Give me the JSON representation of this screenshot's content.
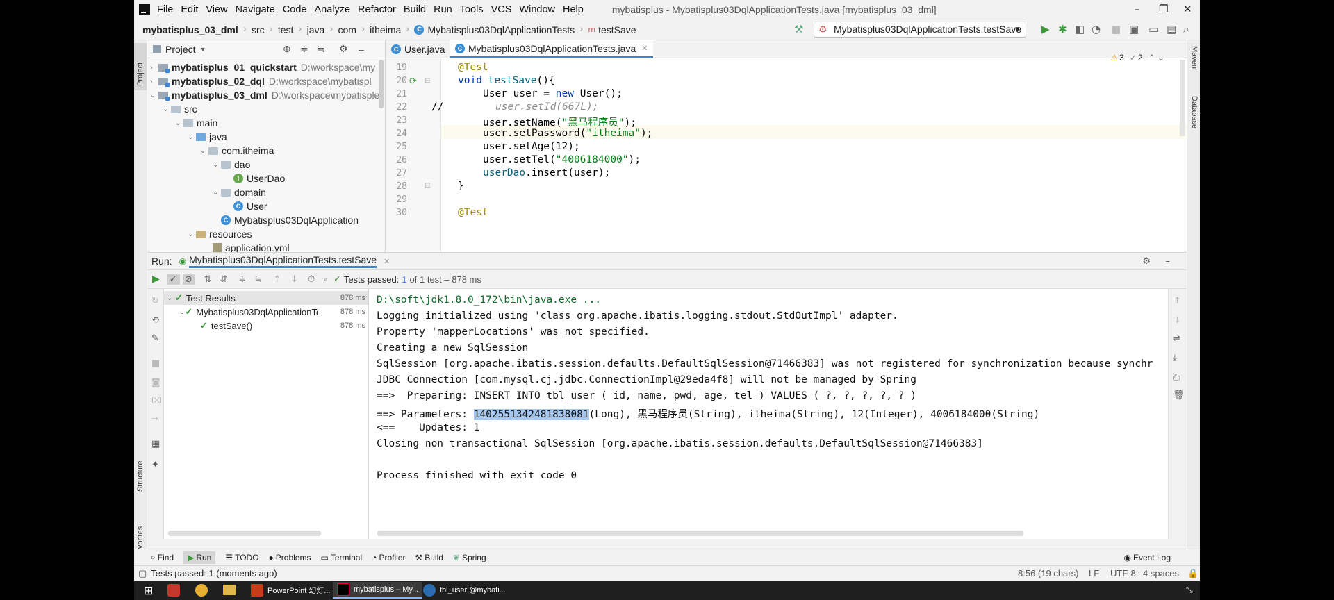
{
  "menubar": {
    "items": [
      "File",
      "Edit",
      "View",
      "Navigate",
      "Code",
      "Analyze",
      "Refactor",
      "Build",
      "Run",
      "Tools",
      "VCS",
      "Window",
      "Help"
    ],
    "window_title": "mybatisplus - Mybatisplus03DqlApplicationTests.java [mybatisplus_03_dml]"
  },
  "breadcrumb": [
    "mybatisplus_03_dml",
    "src",
    "test",
    "java",
    "com",
    "itheima",
    "Mybatisplus03DqlApplicationTests",
    "testSave"
  ],
  "toolbar": {
    "run_config": "Mybatisplus03DqlApplicationTests.testSave"
  },
  "side_strips": {
    "left": [
      "Project",
      "Structure",
      "Favorites"
    ],
    "right": [
      "Maven",
      "Database"
    ]
  },
  "project": {
    "title": "Project",
    "tree": [
      {
        "label": "mybatisplus_01_quickstart",
        "path": "D:\\workspace\\my",
        "type": "module"
      },
      {
        "label": "mybatisplus_02_dql",
        "path": "D:\\workspace\\mybatispl",
        "type": "module"
      },
      {
        "label": "mybatisplus_03_dml",
        "path": "D:\\workspace\\mybatisple",
        "type": "module"
      },
      {
        "label": "src",
        "type": "folder"
      },
      {
        "label": "main",
        "type": "folder"
      },
      {
        "label": "java",
        "type": "src"
      },
      {
        "label": "com.itheima",
        "type": "folder"
      },
      {
        "label": "dao",
        "type": "folder"
      },
      {
        "label": "UserDao",
        "type": "interface"
      },
      {
        "label": "domain",
        "type": "folder"
      },
      {
        "label": "User",
        "type": "class"
      },
      {
        "label": "Mybatisplus03DqlApplication",
        "type": "class"
      },
      {
        "label": "resources",
        "type": "res"
      },
      {
        "label": "application.yml",
        "type": "yml"
      }
    ]
  },
  "editor": {
    "tabs": [
      {
        "label": "User.java"
      },
      {
        "label": "Mybatisplus03DqlApplicationTests.java"
      }
    ],
    "inspections": {
      "warnings": "3",
      "weak": "2"
    },
    "lines": [
      {
        "n": "19",
        "text": "@Test"
      },
      {
        "n": "20",
        "text": "void testSave(){"
      },
      {
        "n": "21",
        "text": "User user = new User();"
      },
      {
        "n": "22",
        "text": "user.setId(667L);"
      },
      {
        "n": "23",
        "text": "user.setName(\"黑马程序员\");"
      },
      {
        "n": "24",
        "text": "user.setPassword(\"itheima\");"
      },
      {
        "n": "25",
        "text": "user.setAge(12);"
      },
      {
        "n": "26",
        "text": "user.setTel(\"4006184000\");"
      },
      {
        "n": "27",
        "text": "userDao.insert(user);"
      },
      {
        "n": "28",
        "text": "}"
      },
      {
        "n": "29",
        "text": ""
      },
      {
        "n": "30",
        "text": "@Test"
      }
    ],
    "comment_marker": "//"
  },
  "run": {
    "label": "Run:",
    "tab": "Mybatisplus03DqlApplicationTests.testSave",
    "tests_passed": "Tests passed:",
    "tests_count": "1",
    "tests_tail": "of 1 test – 878 ms",
    "results": [
      {
        "label": "Test Results",
        "ms": "878 ms"
      },
      {
        "label": "Mybatisplus03DqlApplicationTe",
        "ms": "878 ms"
      },
      {
        "label": "testSave()",
        "ms": "878 ms"
      }
    ],
    "console": [
      "D:\\soft\\jdk1.8.0_172\\bin\\java.exe ...",
      "Logging initialized using 'class org.apache.ibatis.logging.stdout.StdOutImpl' adapter.",
      "Property 'mapperLocations' was not specified.",
      "Creating a new SqlSession",
      "SqlSession [org.apache.ibatis.session.defaults.DefaultSqlSession@71466383] was not registered for synchronization because synchr",
      "JDBC Connection [com.mysql.cj.jdbc.ConnectionImpl@29eda4f8] will not be managed by Spring",
      "==>  Preparing: INSERT INTO tbl_user ( id, name, pwd, age, tel ) VALUES ( ?, ?, ?, ?, ? )",
      "<==    Updates: 1",
      "Closing non transactional SqlSession [org.apache.ibatis.session.defaults.DefaultSqlSession@71466383]",
      "Process finished with exit code 0"
    ],
    "params_prefix": "==> Parameters: ",
    "params_id": "1402551342481838081",
    "params_rest": "(Long), 黑马程序员(String), itheima(String), 12(Integer), 4006184000(String)"
  },
  "bottom_tabs": [
    "Find",
    "Run",
    "TODO",
    "Problems",
    "Terminal",
    "Profiler",
    "Build",
    "Spring"
  ],
  "event_log": "Event Log",
  "status": {
    "message": "Tests passed: 1 (moments ago)",
    "position": "8:56 (19 chars)",
    "line_sep": "LF",
    "encoding": "UTF-8",
    "indent": "4 spaces"
  },
  "taskbar": [
    {
      "label": "PowerPoint 幻灯...",
      "color": "#c43e1c"
    },
    {
      "label": "mybatisplus – My...",
      "color": "#2b2b2b"
    },
    {
      "label": "tbl_user @mybati...",
      "color": "#2b6cb0"
    }
  ]
}
